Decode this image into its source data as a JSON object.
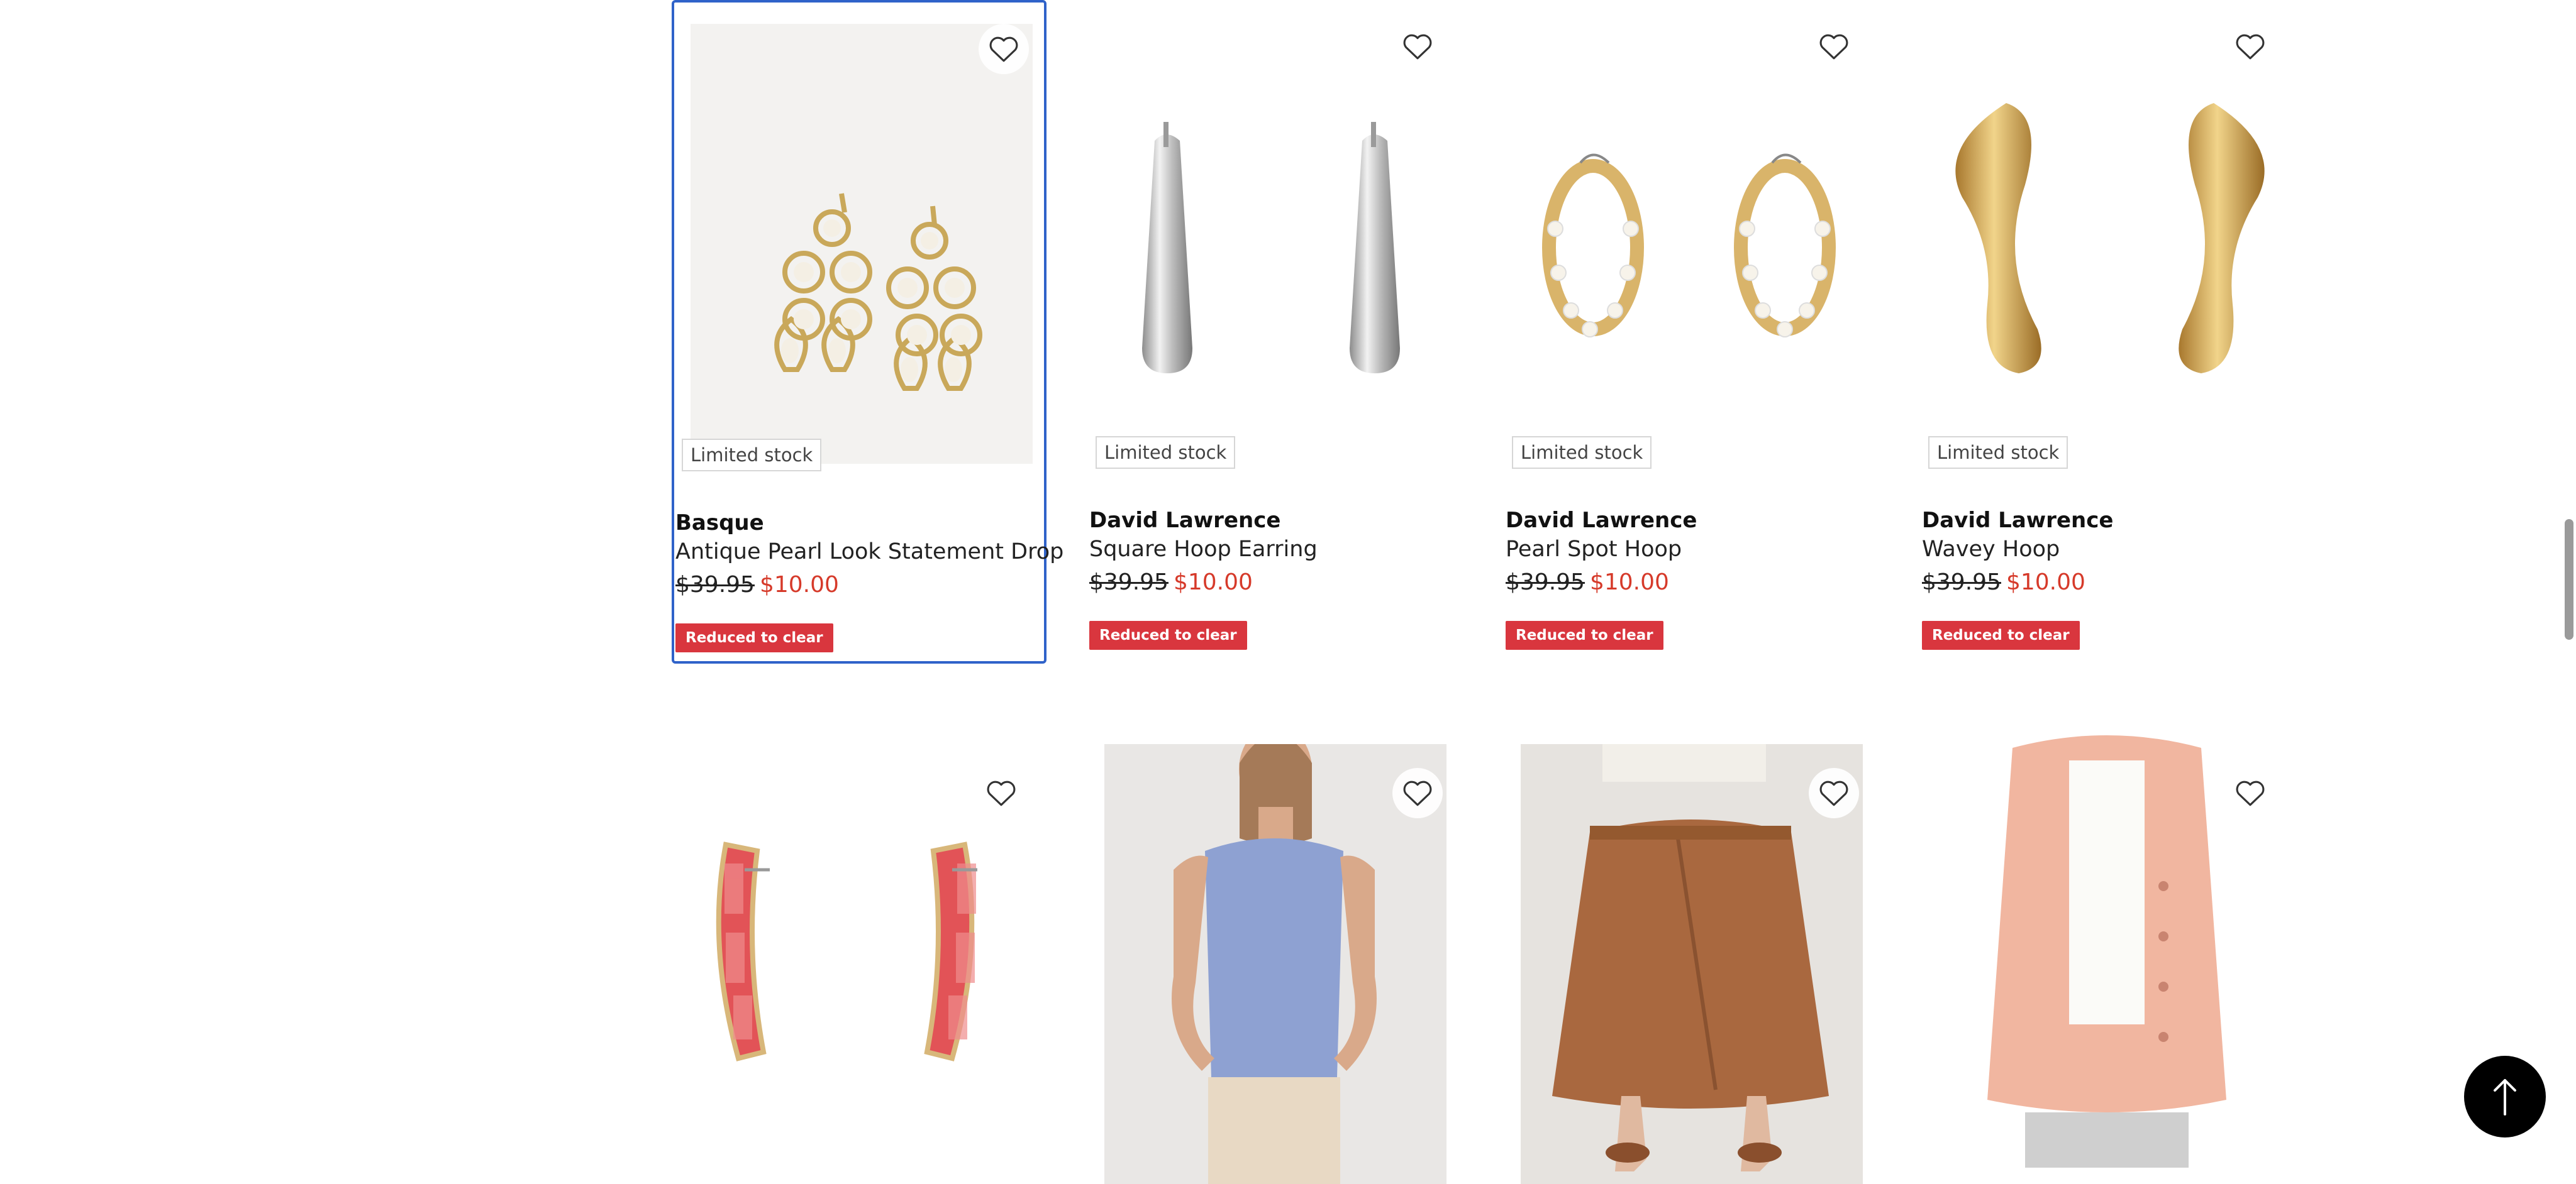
{
  "row1": [
    {
      "stock": "Limited stock",
      "brand": "Basque",
      "name": "Antique Pearl Look Statement Drop",
      "was": "$39.95",
      "now": "$10.00",
      "promo": "Reduced to clear"
    },
    {
      "stock": "Limited stock",
      "brand": "David Lawrence",
      "name": "Square Hoop Earring",
      "was": "$39.95",
      "now": "$10.00",
      "promo": "Reduced to clear"
    },
    {
      "stock": "Limited stock",
      "brand": "David Lawrence",
      "name": "Pearl Spot Hoop",
      "was": "$39.95",
      "now": "$10.00",
      "promo": "Reduced to clear"
    },
    {
      "stock": "Limited stock",
      "brand": "David Lawrence",
      "name": "Wavey Hoop",
      "was": "$39.95",
      "now": "$10.00",
      "promo": "Reduced to clear"
    }
  ],
  "icons": {
    "wishlist": "heart-outline-icon",
    "back_to_top": "arrow-up-icon"
  },
  "colors": {
    "price_sale": "#d63a2a",
    "promo_bg": "#d9363e",
    "focus_border": "#2f62c9"
  }
}
